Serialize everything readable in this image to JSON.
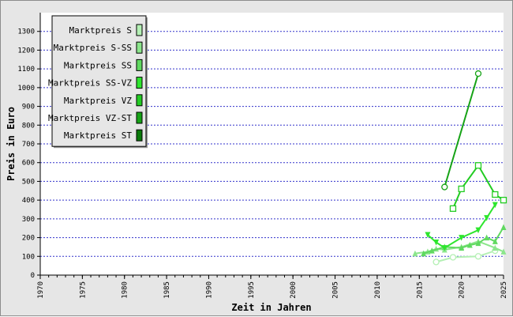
{
  "chart_data": {
    "type": "line",
    "xlabel": "Zeit in Jahren",
    "ylabel": "Preis in Euro",
    "xlim": [
      1970,
      2025
    ],
    "ylim": [
      0,
      1400
    ],
    "x_ticks": [
      1970,
      1975,
      1980,
      1985,
      1990,
      1995,
      2000,
      2005,
      2010,
      2015,
      2020,
      2025
    ],
    "y_ticks": [
      0,
      100,
      200,
      300,
      400,
      500,
      600,
      700,
      800,
      900,
      1000,
      1100,
      1200,
      1300
    ],
    "grid": "horizontal-dotted",
    "legend_position": "top-left",
    "series": [
      {
        "name": "Marktpreis S",
        "color": "#b4f0b4",
        "marker": "circle",
        "points": [
          [
            2017,
            70
          ],
          [
            2019,
            95
          ],
          [
            2022,
            100
          ],
          [
            2024,
            130
          ]
        ]
      },
      {
        "name": "Marktpreis S-SS",
        "color": "#8ce68c",
        "marker": "triangle-up",
        "points": [
          [
            2014.5,
            115
          ],
          [
            2016,
            125
          ],
          [
            2017,
            140
          ],
          [
            2018,
            135
          ],
          [
            2020,
            150
          ],
          [
            2022,
            180
          ],
          [
            2024,
            145
          ],
          [
            2025,
            125
          ]
        ]
      },
      {
        "name": "Marktpreis SS",
        "color": "#60d960",
        "marker": "triangle-up",
        "points": [
          [
            2015.5,
            115
          ],
          [
            2016.5,
            130
          ],
          [
            2018,
            150
          ],
          [
            2020,
            145
          ],
          [
            2021,
            160
          ],
          [
            2022,
            170
          ],
          [
            2023,
            200
          ],
          [
            2024,
            180
          ],
          [
            2025,
            255
          ]
        ]
      },
      {
        "name": "Marktpreis SS-VZ",
        "color": "#2ee62e",
        "marker": "triangle-down",
        "points": [
          [
            2016,
            215
          ],
          [
            2017,
            175
          ],
          [
            2018,
            145
          ],
          [
            2020,
            200
          ],
          [
            2022,
            240
          ],
          [
            2023,
            305
          ],
          [
            2024,
            375
          ]
        ]
      },
      {
        "name": "Marktpreis VZ",
        "color": "#22cc22",
        "marker": "square",
        "points": [
          [
            2019,
            355
          ],
          [
            2020,
            460
          ],
          [
            2022,
            585
          ],
          [
            2024,
            430
          ],
          [
            2025,
            400
          ]
        ]
      },
      {
        "name": "Marktpreis VZ-ST",
        "color": "#16a316",
        "marker": "circle",
        "points": [
          [
            2018,
            470
          ],
          [
            2022,
            1075
          ]
        ]
      },
      {
        "name": "Marktpreis ST",
        "color": "#0a7a0a",
        "marker": "none",
        "points": []
      }
    ]
  }
}
